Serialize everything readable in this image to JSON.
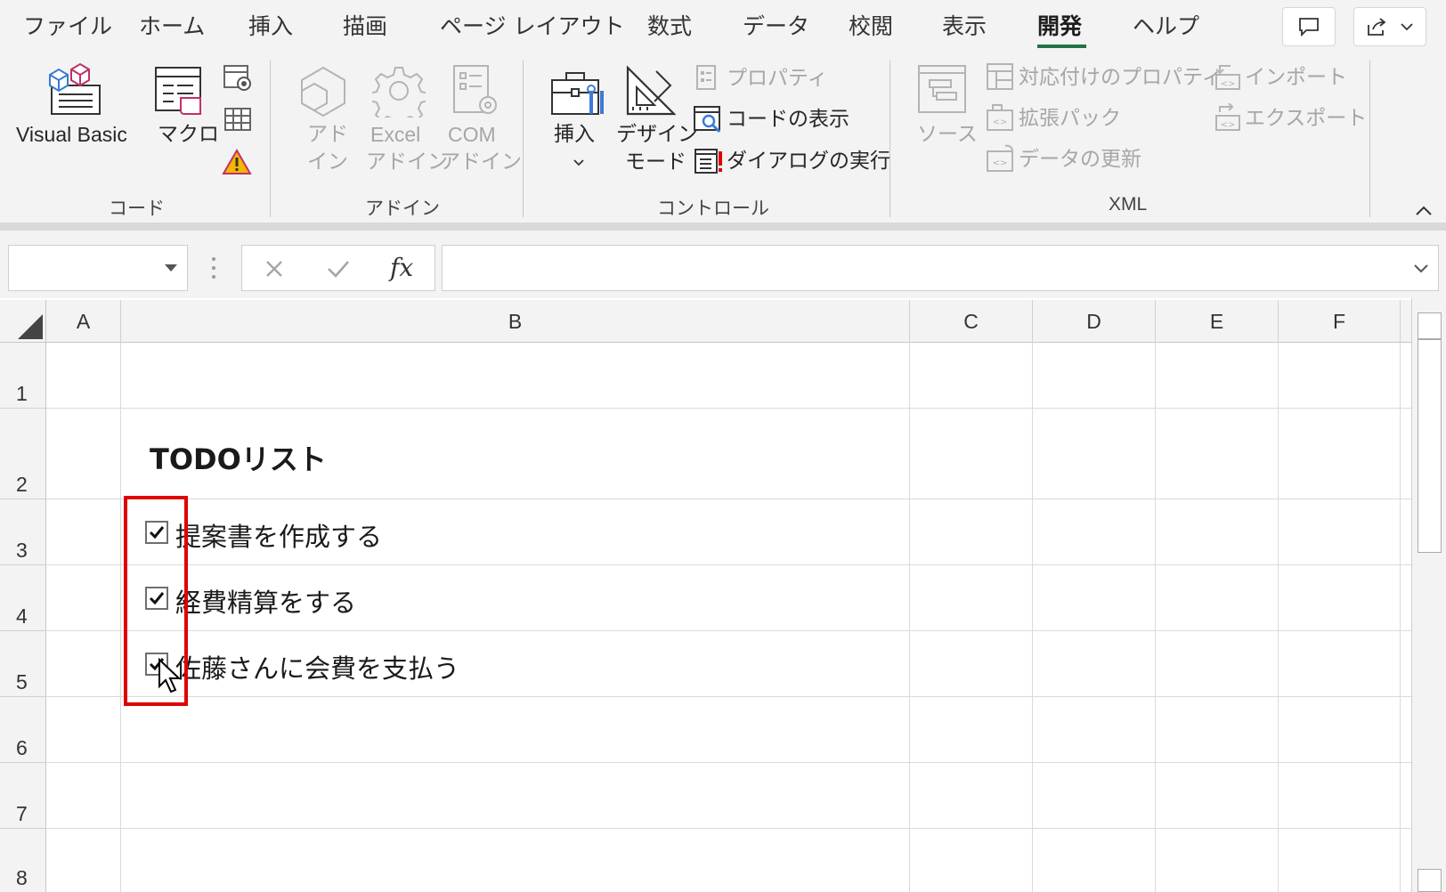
{
  "menu": {
    "tabs": [
      "ファイル",
      "ホーム",
      "挿入",
      "描画",
      "ページ レイアウト",
      "数式",
      "データ",
      "校閲",
      "表示",
      "開発",
      "ヘルプ"
    ],
    "active": "開発"
  },
  "ribbon": {
    "code": {
      "visual_basic": "Visual Basic",
      "macro": "マクロ",
      "group": "コード"
    },
    "addin": {
      "addin_line1": "アド",
      "addin_line2": "イン",
      "excel_line1": "Excel",
      "excel_line2": "アドイン",
      "com_line1": "COM",
      "com_line2": "アドイン",
      "group": "アドイン"
    },
    "controls": {
      "insert": "挿入",
      "design_line1": "デザイン",
      "design_line2": "モード",
      "properties": "プロパティ",
      "view_code": "コードの表示",
      "run_dialog": "ダイアログの実行",
      "group": "コントロール"
    },
    "xml": {
      "source": "ソース",
      "map_properties": "対応付けのプロパティ",
      "expansion_packs": "拡張パック",
      "refresh_data": "データの更新",
      "import": "インポート",
      "export": "エクスポート",
      "group": "XML"
    }
  },
  "formula_bar": {
    "name_box": "",
    "formula": "",
    "fx": "fx"
  },
  "grid": {
    "columns": [
      "A",
      "B",
      "C",
      "D",
      "E",
      "F"
    ],
    "rows": [
      "1",
      "2",
      "3",
      "4",
      "5",
      "6",
      "7",
      "8"
    ],
    "title": "TODOリスト",
    "items": [
      {
        "text": "提案書を作成する",
        "checked": true
      },
      {
        "text": "経費精算をする",
        "checked": true
      },
      {
        "text": "佐藤さんに会費を支払う",
        "checked": true
      }
    ]
  },
  "colors": {
    "accent": "#217346",
    "highlight": "#e00000"
  }
}
